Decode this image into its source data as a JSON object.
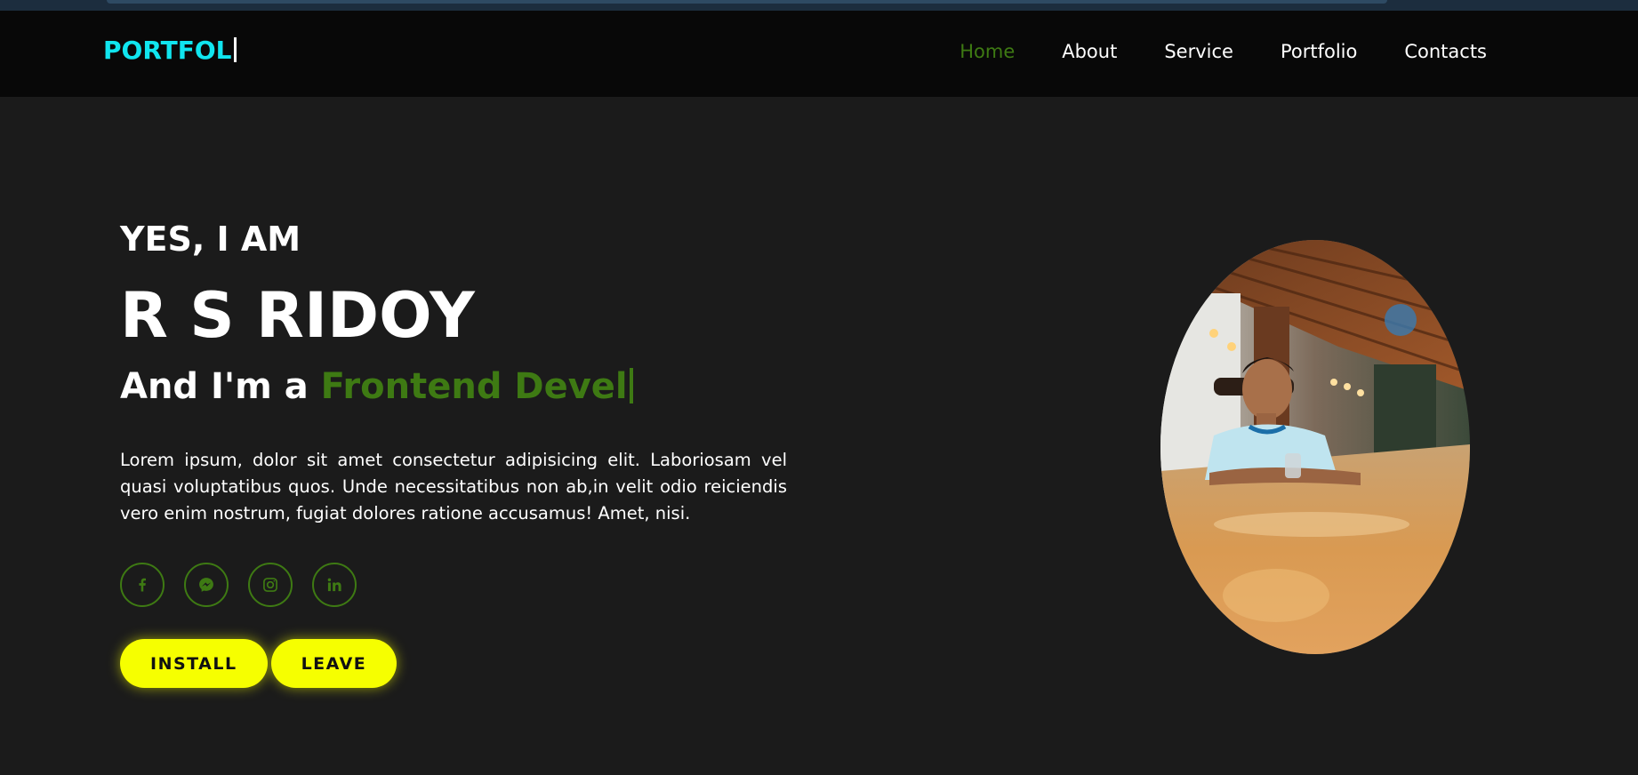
{
  "nav": {
    "logo_text": "PORTFOL",
    "links": [
      {
        "label": "Home",
        "active": true
      },
      {
        "label": "About",
        "active": false
      },
      {
        "label": "Service",
        "active": false
      },
      {
        "label": "Portfolio",
        "active": false
      },
      {
        "label": "Contacts",
        "active": false
      }
    ]
  },
  "hero": {
    "intro": "YES, I AM",
    "name": "R S RIDOY",
    "role_prefix": "And I'm a ",
    "role_typed": "Frontend Devel",
    "description": "Lorem ipsum, dolor sit amet consectetur adipisicing elit. Laboriosam vel quasi voluptatibus quos. Unde necessitatibus non ab,in velit odio reiciendis vero enim nostrum, fugiat dolores ratione accusamus! Amet, nisi.",
    "socials": [
      {
        "icon": "facebook-icon"
      },
      {
        "icon": "messenger-icon"
      },
      {
        "icon": "instagram-icon"
      },
      {
        "icon": "linkedin-icon"
      }
    ],
    "buttons": {
      "install_label": "INSTALL",
      "leave_label": "LEAVE"
    }
  },
  "colors": {
    "background": "#1b1b1b",
    "navbar": "#080808",
    "logo": "#10e5ef",
    "accent_green": "#3e7a13",
    "button_yellow": "#f6ff00"
  }
}
